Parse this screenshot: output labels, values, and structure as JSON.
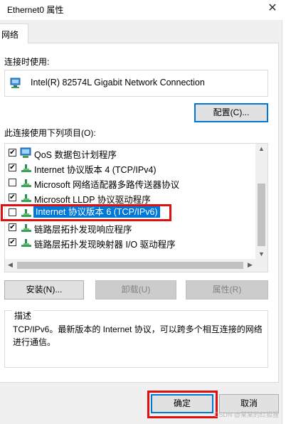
{
  "window": {
    "title": "Ethernet0 属性",
    "close_glyph": "✕"
  },
  "tab": {
    "label": "网络"
  },
  "connect_using": {
    "label": "连接时使用:",
    "adapter": "Intel(R) 82574L Gigabit Network Connection",
    "configure_button": "配置(C)..."
  },
  "items_section": {
    "label": "此连接使用下列项目(O):",
    "items": [
      {
        "label": "QoS 数据包计划程序",
        "checked": true,
        "icon": "qos-icon",
        "selected": false
      },
      {
        "label": "Internet 协议版本 4 (TCP/IPv4)",
        "checked": true,
        "icon": "protocol-icon",
        "selected": false
      },
      {
        "label": "Microsoft 网络适配器多路传送器协议",
        "checked": false,
        "icon": "protocol-icon",
        "selected": false
      },
      {
        "label": "Microsoft LLDP 协议驱动程序",
        "checked": true,
        "icon": "protocol-icon",
        "selected": false
      },
      {
        "label": "Internet 协议版本 6 (TCP/IPv6)",
        "checked": false,
        "icon": "protocol-icon",
        "selected": true
      },
      {
        "label": "链路层拓扑发现响应程序",
        "checked": true,
        "icon": "protocol-icon",
        "selected": false
      },
      {
        "label": "链路层拓扑发现映射器 I/O 驱动程序",
        "checked": true,
        "icon": "protocol-icon",
        "selected": false
      }
    ]
  },
  "buttons": {
    "install": "安装(N)...",
    "uninstall": "卸载(U)",
    "properties": "属性(R)",
    "ok": "确定",
    "cancel": "取消"
  },
  "description": {
    "legend": "描述",
    "text": "TCP/IPv6。最新版本的 Internet 协议，可以跨多个相互连接的网络进行通信。"
  },
  "watermark": "CSDN @某某的红狐狸",
  "colors": {
    "selection": "#0078d7",
    "highlight_box": "#e01010",
    "dialog_bg": "#f0f0f0"
  }
}
